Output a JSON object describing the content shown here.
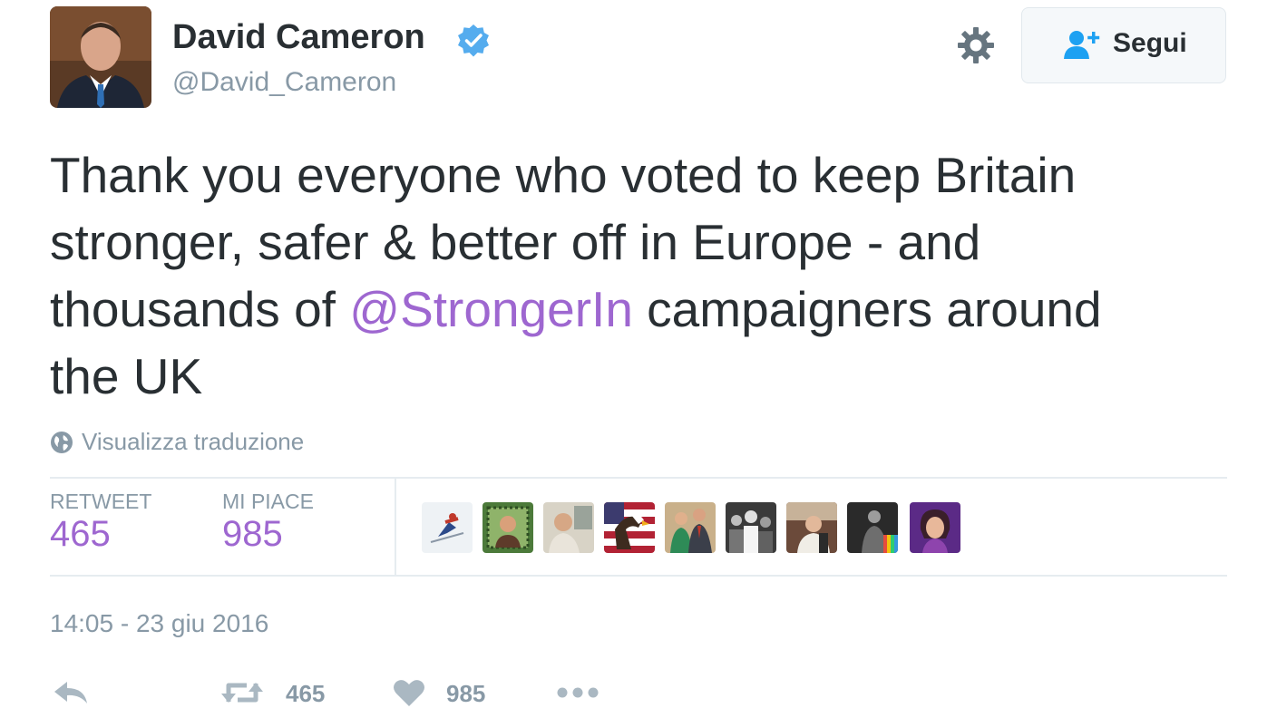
{
  "profile": {
    "name": "David Cameron",
    "handle": "@David_Cameron",
    "verified": true,
    "avatar_icon": "avatar-photo"
  },
  "follow_button": {
    "label": "Segui",
    "icon": "add-user-icon"
  },
  "settings_icon": "gear-icon",
  "tweet": {
    "line1": "Thank you everyone who voted to keep Britain",
    "line2": "stronger, safer & better off in Europe - and",
    "line3_pre": "thousands of ",
    "mention": "@StrongerIn",
    "line3_post": " campaigners around",
    "line4": "the UK"
  },
  "translate": {
    "label": "Visualizza traduzione",
    "icon": "globe-icon"
  },
  "stats": {
    "retweets_label": "RETWEET",
    "retweets_value": "465",
    "likes_label": "MI PIACE",
    "likes_value": "985"
  },
  "likers": [
    "skier-avatar",
    "framed-portrait-avatar",
    "man-avatar",
    "eagle-flag-avatar",
    "couple-avatar",
    "crowd-bw-avatar",
    "portrait-avatar",
    "stage-avatar",
    "purple-woman-avatar"
  ],
  "timestamp": "14:05 - 23 giu 2016",
  "actions": {
    "reply_icon": "reply-icon",
    "retweet_icon": "retweet-icon",
    "retweet_count": "465",
    "like_icon": "heart-icon",
    "like_count": "985",
    "more_icon": "more-icon"
  },
  "colors": {
    "accent": "#9e67d0",
    "text": "#292f33",
    "muted": "#8899a6",
    "verified": "#55acee",
    "follow_icon": "#1da1f2",
    "divider": "#e6ecf0"
  }
}
